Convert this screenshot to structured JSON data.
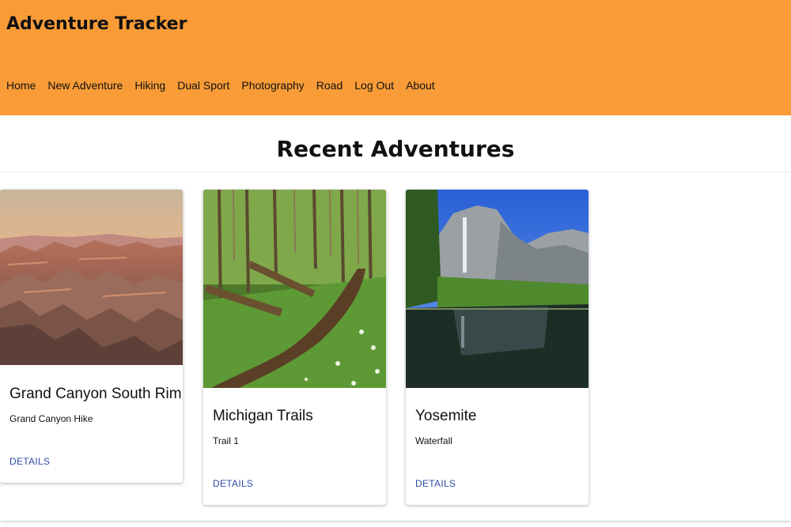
{
  "header": {
    "title": "Adventure Tracker",
    "nav": [
      "Home",
      "New Adventure",
      "Hiking",
      "Dual Sport",
      "Photography",
      "Road",
      "Log Out",
      "About"
    ]
  },
  "main": {
    "title": "Recent Adventures",
    "cards": [
      {
        "title": "Grand Canyon South Rim",
        "subtitle": "Grand Canyon Hike",
        "action": "DETAILS",
        "image": "canyon-photo"
      },
      {
        "title": "Michigan Trails",
        "subtitle": "Trail 1",
        "action": "DETAILS",
        "image": "forest-trail-photo"
      },
      {
        "title": "Yosemite",
        "subtitle": "Waterfall",
        "action": "DETAILS",
        "image": "waterfall-lake-photo"
      }
    ]
  },
  "colors": {
    "header_bg": "#f99c38",
    "link": "#2f4ca8"
  }
}
